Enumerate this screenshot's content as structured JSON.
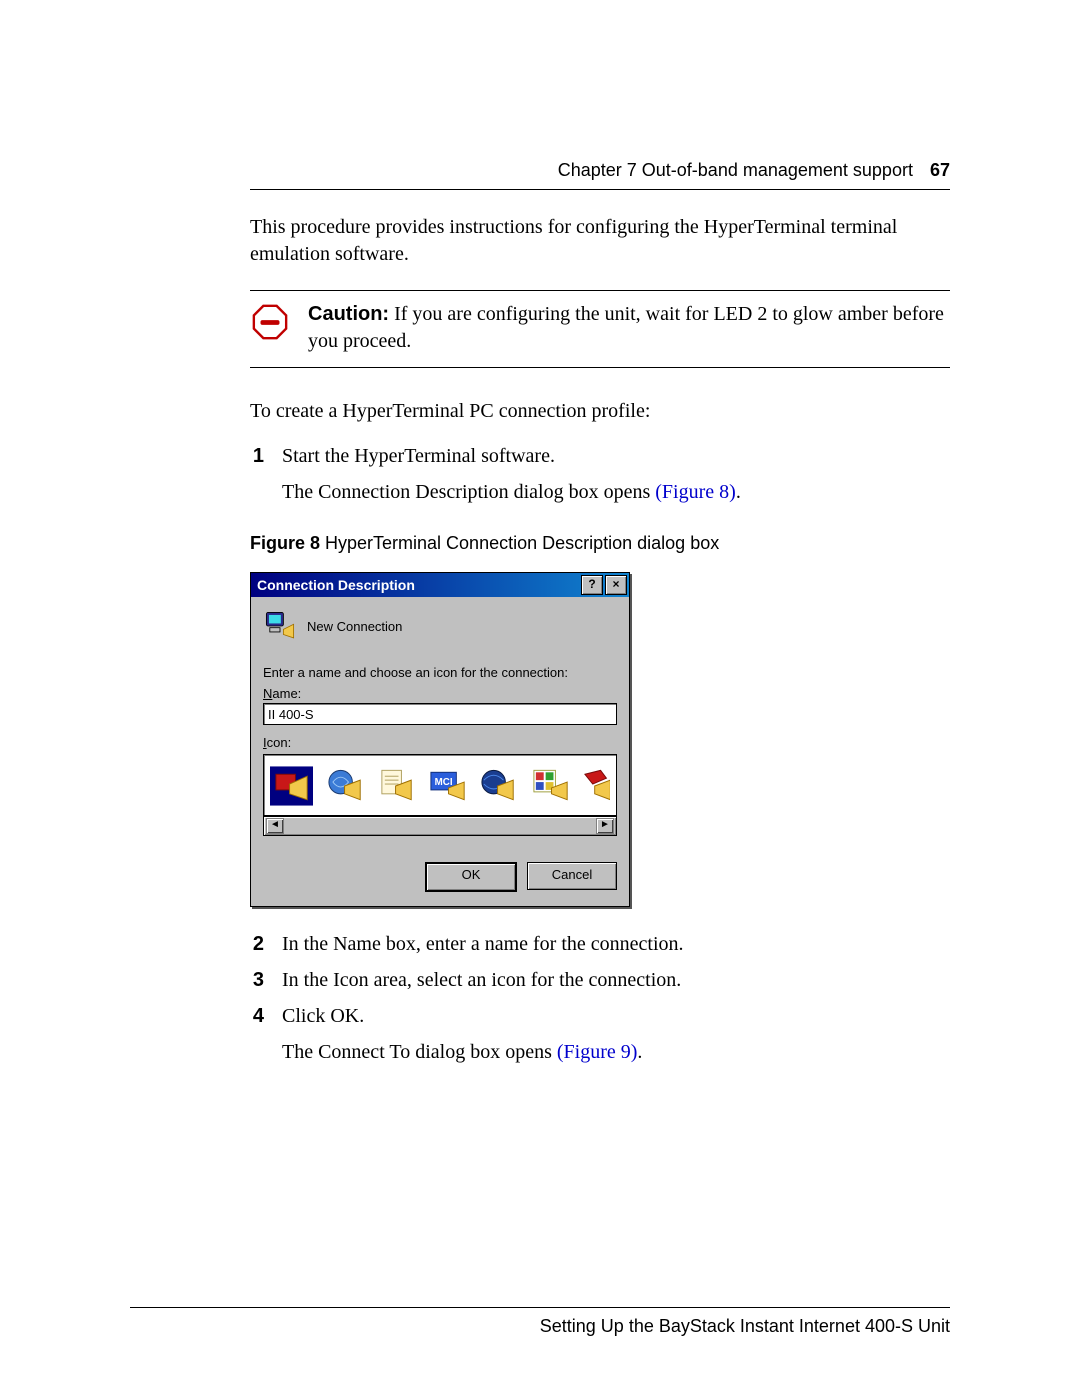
{
  "header": {
    "chapter": "Chapter 7  Out-of-band management support",
    "page_number": "67"
  },
  "intro": "This procedure provides instructions for configuring the HyperTerminal terminal emulation software.",
  "caution": {
    "label": "Caution:",
    "text": " If you are configuring the unit, wait for LED 2 to glow amber before you proceed."
  },
  "lead_in": "To create a HyperTerminal PC connection profile:",
  "steps": [
    {
      "num": "1",
      "text": "Start the HyperTerminal software.",
      "sub": "The Connection Description dialog box opens ",
      "link": "(Figure 8)",
      "after_link": "."
    },
    {
      "num": "2",
      "text": "In the Name box, enter a name for the connection."
    },
    {
      "num": "3",
      "text": "In the Icon area, select an icon for the connection."
    },
    {
      "num": "4",
      "text": "Click OK.",
      "sub": "The Connect To dialog box opens ",
      "link": "(Figure 9)",
      "after_link": "."
    }
  ],
  "figure": {
    "label": "Figure 8",
    "caption": "   HyperTerminal Connection Description dialog box"
  },
  "dialog": {
    "title": "Connection Description",
    "help_btn": "?",
    "close_btn": "×",
    "new_connection": "New Connection",
    "prompt": "Enter a name and choose an icon for the connection:",
    "name_label_prefix": "N",
    "name_label_rest": "ame:",
    "name_value": "II 400-S",
    "icon_label_prefix": "I",
    "icon_label_rest": "con:",
    "mci_badge": "MCI",
    "ok": "OK",
    "cancel": "Cancel",
    "scroll_left": "◄",
    "scroll_right": "►"
  },
  "footer": "Setting Up the BayStack Instant Internet 400-S Unit"
}
